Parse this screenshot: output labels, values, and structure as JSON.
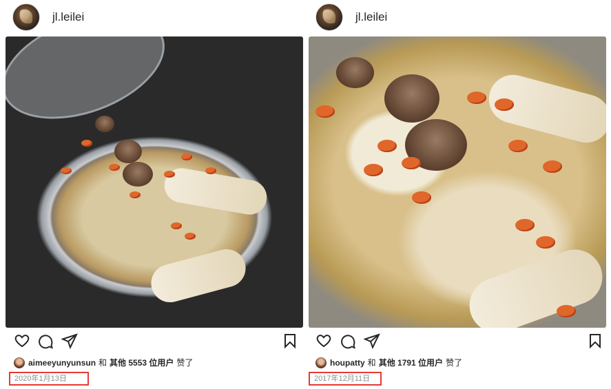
{
  "posts": [
    {
      "username": "jl.leilei",
      "liker": "aimeeyunyunsun",
      "conjunction": "和",
      "others": "其他 5553 位用户",
      "suffix": "赞了",
      "date": "2020年1月13日"
    },
    {
      "username": "jl.leilei",
      "liker": "houpatty",
      "conjunction": "和",
      "others": "其他 1791 位用户",
      "suffix": "赞了",
      "date": "2017年12月11日"
    }
  ],
  "icons": {
    "like": "heart-icon",
    "comment": "comment-icon",
    "share": "send-icon",
    "save": "bookmark-icon"
  },
  "colors": {
    "highlight_box": "#e53935",
    "text": "#262626",
    "muted": "#8e8e8e"
  }
}
